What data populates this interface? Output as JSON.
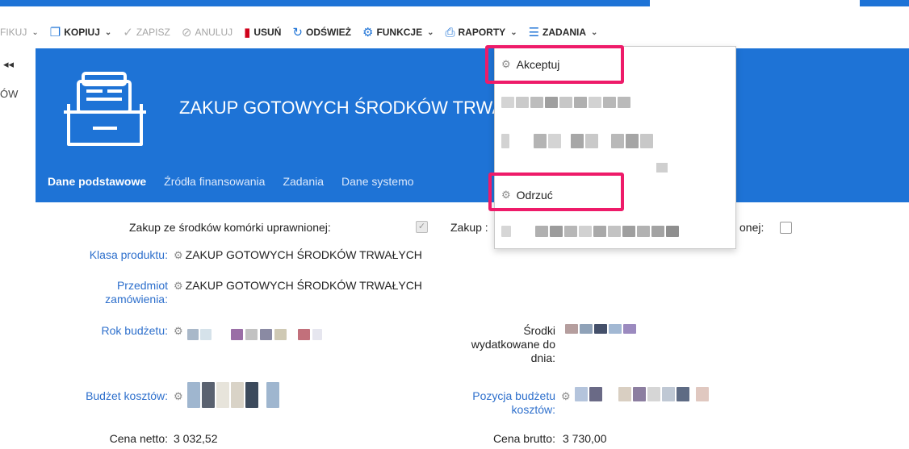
{
  "toolbar": {
    "modify_label": "FIKUJ",
    "copy_label": "KOPIUJ",
    "save_label": "ZAPISZ",
    "cancel_label": "ANULUJ",
    "delete_label": "USUŃ",
    "refresh_label": "ODŚWIEŻ",
    "functions_label": "FUNKCJE",
    "reports_label": "RAPORTY",
    "tasks_label": "ZADANIA"
  },
  "sidebar": {
    "collapse_glyph": "◂◂",
    "stub_text": "ÓW"
  },
  "header": {
    "title": "ZAKUP GOTOWYCH ŚRODKÓW TRWA"
  },
  "tabs": [
    {
      "label": "Dane podstawowe",
      "active": true
    },
    {
      "label": "Źródła finansowania"
    },
    {
      "label": "Zadania"
    },
    {
      "label": "Dane systemo"
    }
  ],
  "form": {
    "own_funds_label": "Zakup ze środków komórki uprawnionej:",
    "own_funds_checked": true,
    "other_label_prefix": "Zakup :",
    "other_label_suffix": "onej:",
    "other_checked": false,
    "product_class_label": "Klasa produktu:",
    "product_class_value": "ZAKUP GOTOWYCH ŚRODKÓW TRWAŁYCH",
    "subject_label_1": "Przedmiot",
    "subject_label_2": "zamówienia:",
    "subject_value": "ZAKUP GOTOWYCH ŚRODKÓW TRWAŁYCH",
    "budget_year_label": "Rok budżetu:",
    "spent_label_1": "Środki",
    "spent_label_2": "wydatkowane do",
    "spent_label_3": "dnia:",
    "cost_budget_label": "Budżet kosztów:",
    "budget_position_label_1": "Pozycja budżetu",
    "budget_position_label_2": "kosztów:",
    "net_price_label": "Cena netto:",
    "net_price_value": "3 032,52",
    "gross_price_label": "Cena brutto:",
    "gross_price_value": "3 730,00"
  },
  "functions_menu": {
    "items": [
      {
        "label": "Akceptuj",
        "highlighted": true
      },
      {
        "label": "Odrzuć",
        "highlighted": true
      }
    ]
  },
  "colors": {
    "primary": "#1e73d6",
    "highlight": "#ee1b69",
    "link": "#2d6fcc",
    "delete": "#d0021b"
  }
}
